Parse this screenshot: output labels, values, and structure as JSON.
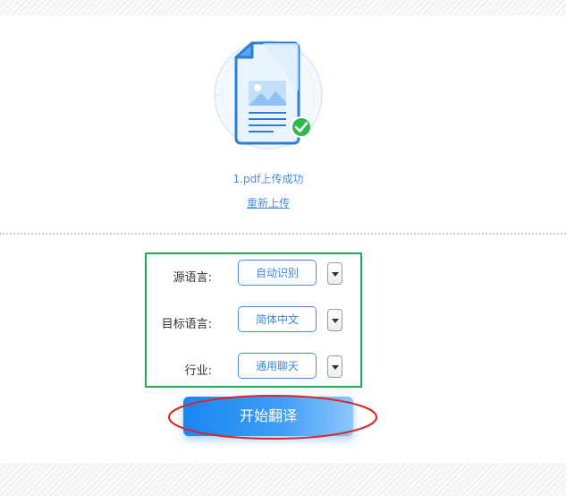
{
  "upload": {
    "status_text": "1.pdf上传成功",
    "reupload_label": "重新上传"
  },
  "options": [
    {
      "label": "源语言:",
      "value": "自动识别"
    },
    {
      "label": "目标语言:",
      "value": "简体中文"
    },
    {
      "label": "行业:",
      "value": "通用聊天"
    }
  ],
  "actions": {
    "start_label": "开始翻译"
  },
  "colors": {
    "accent_blue": "#4a90d9",
    "button_blue": "#1a86f2",
    "highlight_green": "#1faa5a",
    "annotation_red": "#d6262a",
    "success_green": "#2dbb4a"
  },
  "icons": {
    "document": "document-icon",
    "success": "checkmark-icon",
    "dropdown": "chevron-down-icon"
  }
}
